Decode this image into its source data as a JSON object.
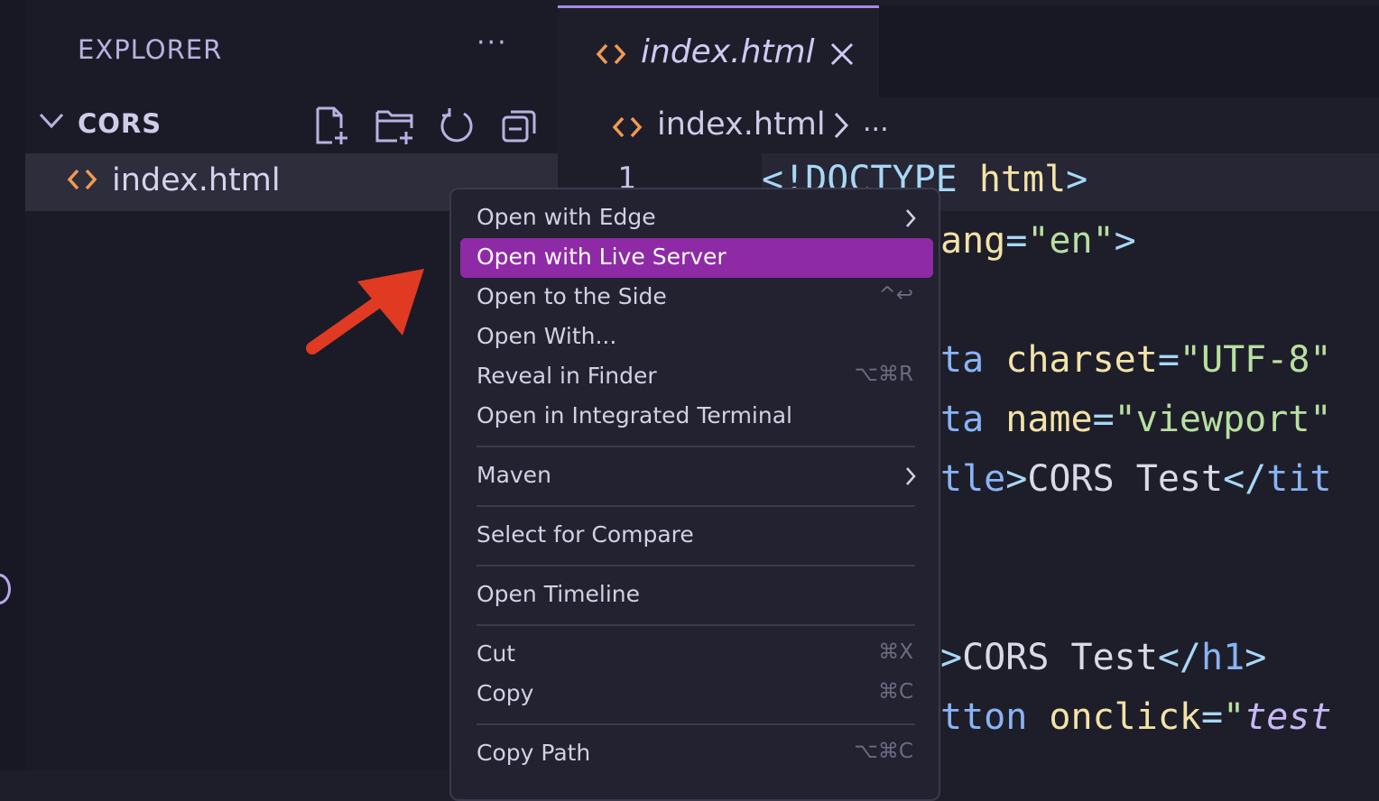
{
  "sidebar": {
    "title": "EXPLORER",
    "more": "···",
    "folder": "CORS",
    "file": "index.html"
  },
  "editor": {
    "tab_label": "index.html",
    "breadcrumb": "index.html",
    "breadcrumb_more": "...",
    "line_number": "1",
    "code": {
      "l1a": "<!DOCTYPE ",
      "l1b": "html",
      "l1c": ">",
      "l2a": "ang",
      "l2b": "=",
      "l2c": "\"en\"",
      "l2d": ">",
      "l3a": "ta ",
      "l3b": "charset",
      "l3c": "=",
      "l3d": "\"UTF-8\"",
      "l4a": "ta ",
      "l4b": "name",
      "l4c": "=",
      "l4d": "\"viewport\"",
      "l5a": "tle",
      "l5b": ">",
      "l5c": "CORS Test",
      "l5d": "</",
      "l5e": "tit",
      "l6a": ">",
      "l6b": "CORS Test",
      "l6c": "</",
      "l6d": "h1",
      "l6e": ">",
      "l7a": "tton ",
      "l7b": "onclick",
      "l7c": "=",
      "l7d": "\"",
      "l7e": "test"
    }
  },
  "context_menu": {
    "open_with_edge": "Open with Edge",
    "open_live_server": "Open with Live Server",
    "open_side": "Open to the Side",
    "open_side_sc": "^↩",
    "open_with": "Open With...",
    "reveal_finder": "Reveal in Finder",
    "reveal_finder_sc": "⌥⌘R",
    "open_terminal": "Open in Integrated Terminal",
    "maven": "Maven",
    "select_compare": "Select for Compare",
    "open_timeline": "Open Timeline",
    "cut": "Cut",
    "cut_sc": "⌘X",
    "copy": "Copy",
    "copy_sc": "⌘C",
    "copy_path": "Copy Path",
    "copy_path_sc": "⌥⌘C"
  },
  "colors": {
    "accent": "#8f2aa6",
    "annotation_arrow": "#e03a22",
    "background": "#1e1e2b"
  },
  "icons": [
    "new-file-icon",
    "new-folder-icon",
    "refresh-icon",
    "collapse-all-icon",
    "html-file-icon",
    "close-icon",
    "chevron-down-icon",
    "chevron-right-icon"
  ]
}
